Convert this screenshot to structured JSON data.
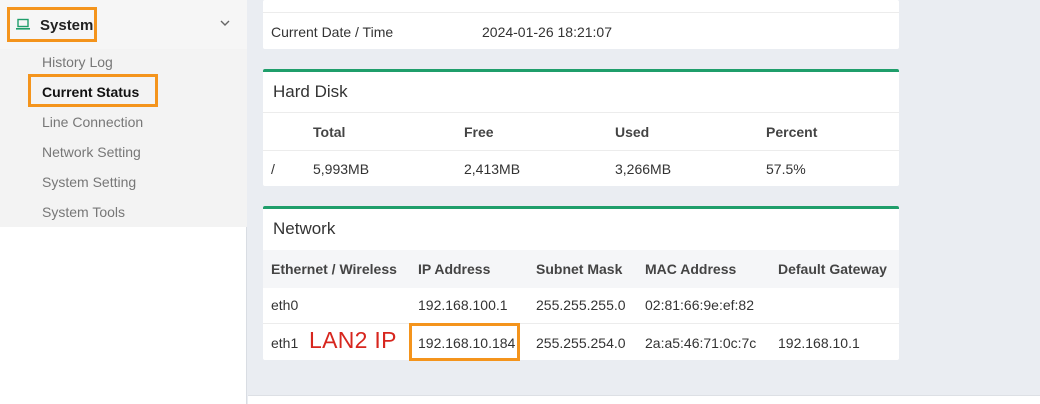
{
  "sidebar": {
    "section_label": "System",
    "section_icon": "laptop-icon",
    "items": [
      {
        "label": "History Log"
      },
      {
        "label": "Current Status"
      },
      {
        "label": "Line Connection"
      },
      {
        "label": "Network Setting"
      },
      {
        "label": "System Setting"
      },
      {
        "label": "System Tools"
      }
    ]
  },
  "datetime": {
    "label": "Current Date / Time",
    "value": "2024-01-26 18:21:07"
  },
  "hard_disk": {
    "title": "Hard Disk",
    "headers": [
      "Total",
      "Free",
      "Used",
      "Percent"
    ],
    "rows": [
      {
        "mount": "/",
        "total": "5,993MB",
        "free": "2,413MB",
        "used": "3,266MB",
        "percent": "57.5%"
      }
    ]
  },
  "network": {
    "title": "Network",
    "headers": [
      "Ethernet / Wireless",
      "IP Address",
      "Subnet Mask",
      "MAC Address",
      "Default Gateway"
    ],
    "rows": [
      {
        "iface": "eth0",
        "ip": "192.168.100.1",
        "mask": "255.255.255.0",
        "mac": "02:81:66:9e:ef:82",
        "gateway": ""
      },
      {
        "iface": "eth1",
        "ip": "192.168.10.184",
        "mask": "255.255.254.0",
        "mac": "2a:a5:46:71:0c:7c",
        "gateway": "192.168.10.1"
      }
    ]
  },
  "annotation": {
    "text": "LAN2 IP"
  },
  "colors": {
    "accent": "#1f9e6b",
    "highlight": "#f4941c",
    "annotation": "#d7261e"
  }
}
